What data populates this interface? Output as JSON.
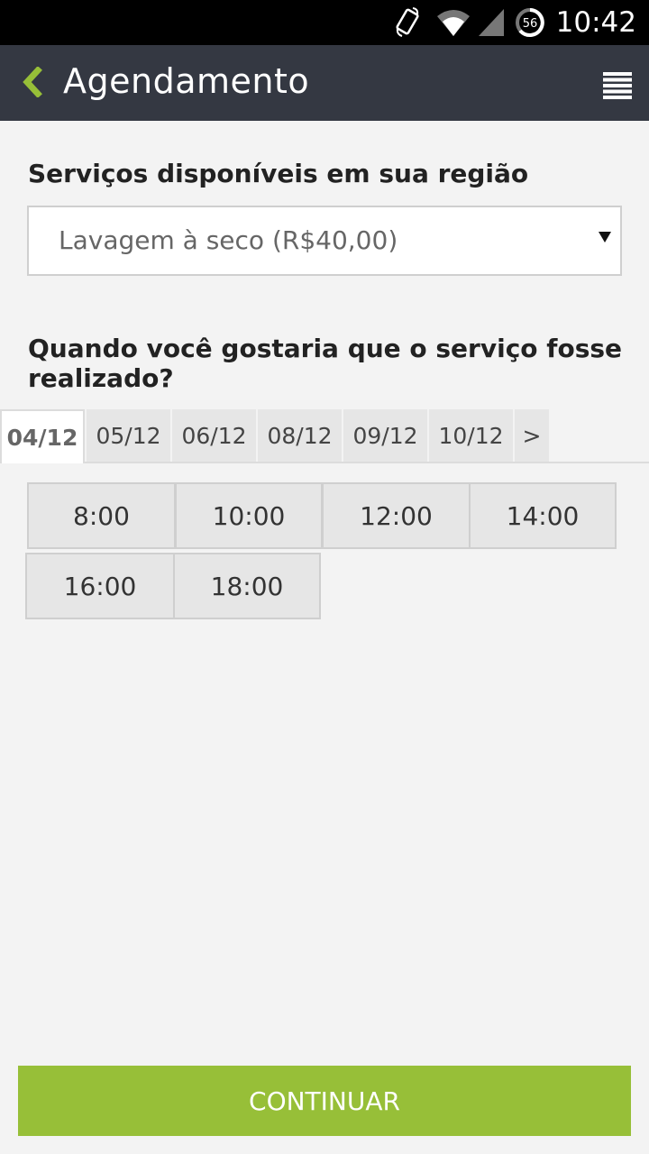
{
  "status_bar": {
    "time": "10:42",
    "battery_level": "56",
    "icons": [
      "phone-rotate-icon",
      "wifi-icon",
      "signal-icon",
      "battery-icon"
    ]
  },
  "app_bar": {
    "title": "Agendamento",
    "icons": [
      "back-chevron-icon",
      "menu-icon"
    ],
    "background": "#343842",
    "accent": "#97bf38"
  },
  "services": {
    "label": "Serviços disponíveis em sua região",
    "selected": "Lavagem à seco (R$40,00)",
    "dropdown_icon": "caret-down-icon"
  },
  "schedule": {
    "label": "Quando você gostaria que o serviço fosse realizado?",
    "dates": [
      "04/12",
      "05/12",
      "06/12",
      "08/12",
      "09/12",
      "10/12"
    ],
    "selected_date": "04/12",
    "next_label": ">",
    "times": [
      "8:00",
      "10:00",
      "12:00",
      "14:00",
      "16:00",
      "18:00"
    ]
  },
  "actions": {
    "continue_label": "CONTINUAR",
    "continue_color": "#97bf38"
  }
}
